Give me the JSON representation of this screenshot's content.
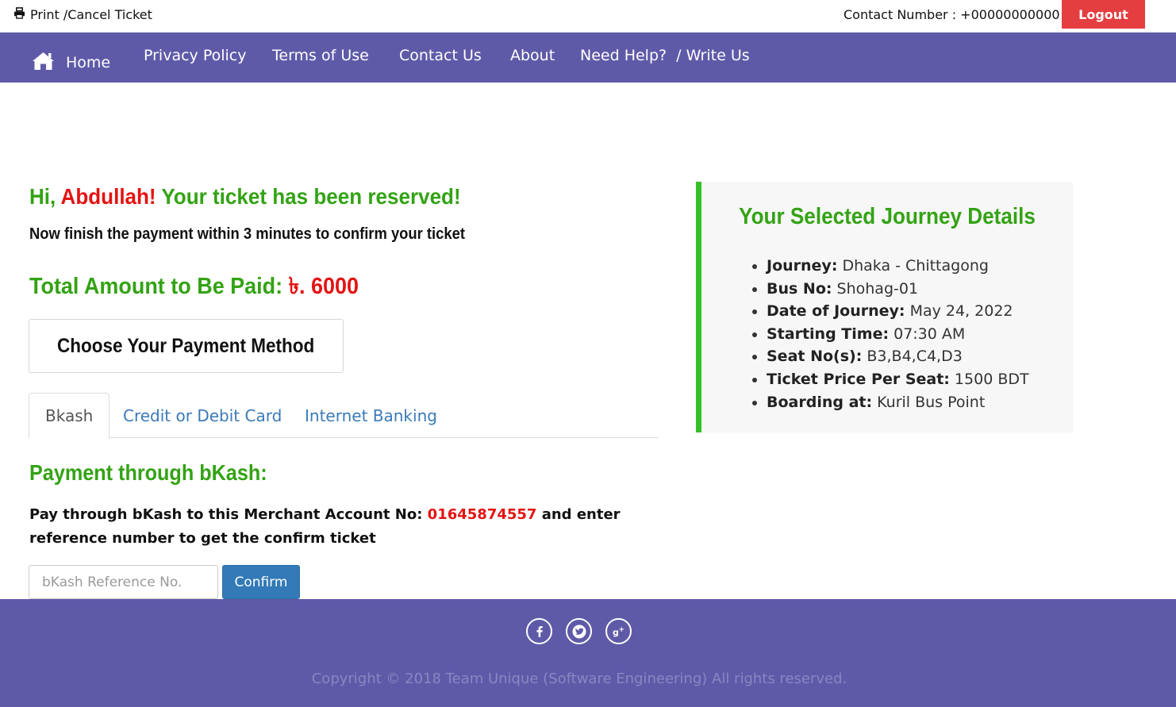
{
  "topbar": {
    "print_cancel": "Print /Cancel Ticket",
    "contact": "Contact Number : +00000000000",
    "logout": "Logout"
  },
  "nav": {
    "home": "Home",
    "privacy": "Privacy Policy",
    "terms": "Terms of Use",
    "contact": "Contact Us",
    "about": "About",
    "help": "Need Help?  / Write Us"
  },
  "greeting": {
    "hi": "Hi, ",
    "name": "Abdullah!",
    "message": " Your ticket has been reserved!"
  },
  "subline": "Now finish the payment within 3 minutes to confirm your ticket",
  "total": {
    "label": "Total Amount to Be Paid: ",
    "amount": "৳. 6000"
  },
  "choose_method": "Choose Your Payment Method",
  "tabs": [
    "Bkash",
    "Credit or Debit Card",
    "Internet Banking"
  ],
  "active_tab": "Bkash",
  "payment": {
    "heading": "Payment through bKash:",
    "desc_before": "Pay through bKash to this Merchant Account No: ",
    "account": "01645874557",
    "desc_after": " and enter reference number to get the confirm ticket",
    "input_placeholder": "bKash Reference No.",
    "input_value": "",
    "confirm": "Confirm"
  },
  "journey": {
    "title": "Your Selected Journey Details",
    "items": [
      {
        "label": "Journey:",
        "value": " Dhaka - Chittagong"
      },
      {
        "label": "Bus No:",
        "value": " Shohag-01"
      },
      {
        "label": "Date of Journey:",
        "value": " May 24, 2022"
      },
      {
        "label": "Starting Time:",
        "value": " 07:30 AM"
      },
      {
        "label": "Seat No(s):",
        "value": " B3,B4,C4,D3"
      },
      {
        "label": "Ticket Price Per Seat:",
        "value": " 1500 BDT"
      },
      {
        "label": "Boarding at:",
        "value": " Kuril Bus Point"
      }
    ]
  },
  "footer": {
    "social_icons": [
      "facebook-icon",
      "twitter-icon",
      "google-plus-icon"
    ],
    "copyright": "Copyright © 2018 Team Unique (Software Engineering) All rights reserved."
  },
  "colors": {
    "nav_bg": "#5f5aa8",
    "green": "#33a314",
    "red": "#e41313",
    "logout_bg": "#e53e40",
    "primary": "#337ab7",
    "journey_border": "#35c126"
  }
}
